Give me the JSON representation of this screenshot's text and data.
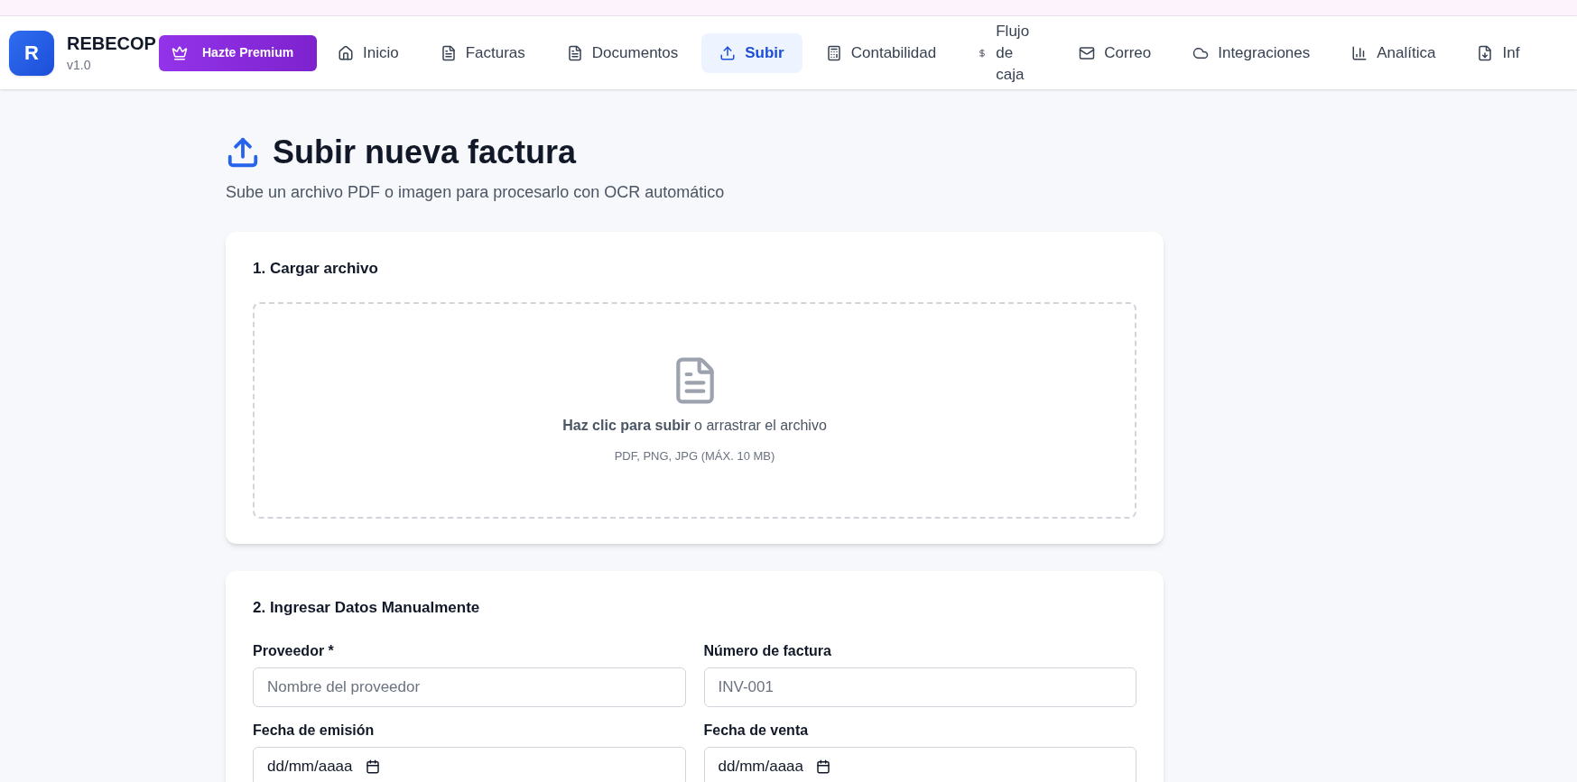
{
  "app": {
    "logo_letter": "R",
    "name": "REBECOP",
    "version": "v1.0"
  },
  "premium_button": {
    "label": "Hazte Premium"
  },
  "nav": [
    {
      "label": "Inicio",
      "selected": false
    },
    {
      "label": "Facturas",
      "selected": false
    },
    {
      "label": "Documentos",
      "selected": false
    },
    {
      "label": "Subir",
      "selected": true
    },
    {
      "label": "Contabilidad",
      "selected": false
    },
    {
      "label": "Flujo de caja",
      "selected": false
    },
    {
      "label": "Correo",
      "selected": false
    },
    {
      "label": "Integraciones",
      "selected": false
    },
    {
      "label": "Analítica",
      "selected": false
    },
    {
      "label": "Inf",
      "selected": false
    }
  ],
  "page": {
    "title": "Subir nueva factura",
    "subtitle": "Sube un archivo PDF o imagen para procesarlo con OCR automático"
  },
  "upload_card": {
    "title": "1. Cargar archivo",
    "prompt": "**Haz clic para subir** o arrastrar el archivo",
    "formats": "PDF, PNG, JPG (MÁX. 10 MB)"
  },
  "manual_card": {
    "title": "2. Ingresar Datos Manualmente",
    "fields": [
      {
        "label": "Proveedor *",
        "kind": "text",
        "placeholder": "Nombre del proveedor"
      },
      {
        "label": "Número de factura",
        "kind": "text",
        "placeholder": "INV-001"
      },
      {
        "label": "Fecha de emisión",
        "kind": "date",
        "value": "dd/mm/aaaa"
      },
      {
        "label": "Fecha de venta",
        "kind": "date",
        "value": "dd/mm/aaaa"
      }
    ]
  }
}
